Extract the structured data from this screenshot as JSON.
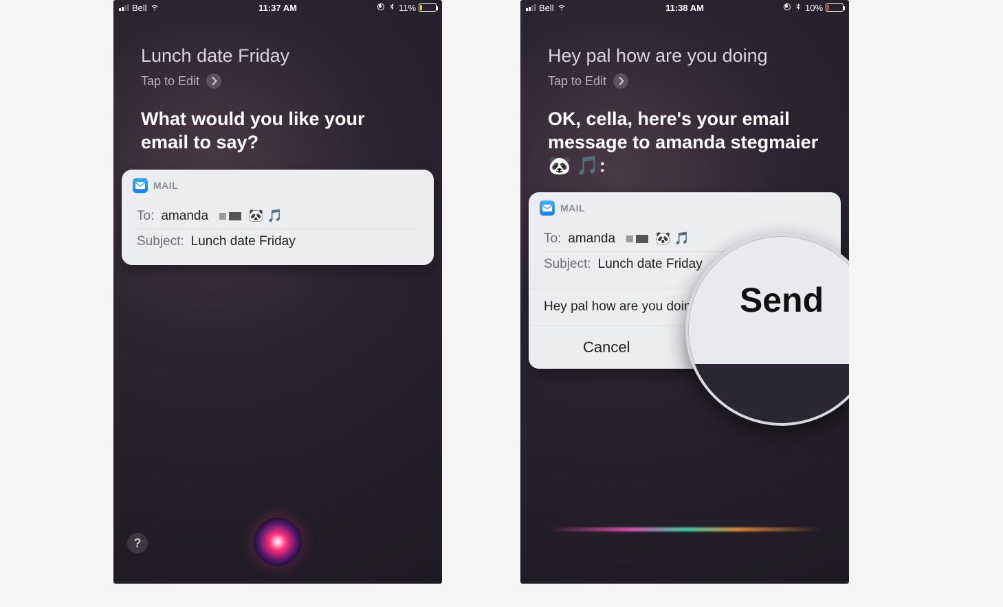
{
  "left": {
    "status": {
      "carrier": "Bell",
      "time": "11:37 AM",
      "battery_pct": "11%",
      "battery_color": "#ffcc00",
      "battery_fill_pct": 11
    },
    "user_said": "Lunch date Friday",
    "tap_to_edit": "Tap to Edit",
    "siri_prompt": "What would you like your email to say?",
    "mail": {
      "app_label": "MAIL",
      "to_label": "To:",
      "to_value": "amanda",
      "to_trailing": "🐼 🎵",
      "subject_label": "Subject:",
      "subject_value": "Lunch date Friday"
    }
  },
  "right": {
    "status": {
      "carrier": "Bell",
      "time": "11:38 AM",
      "battery_pct": "10%",
      "battery_color": "#ff3b30",
      "battery_fill_pct": 10
    },
    "user_said": "Hey pal how are you doing",
    "tap_to_edit": "Tap to Edit",
    "siri_prompt": "OK, cella, here's your email message to amanda stegmaier 🐼 🎵:",
    "mail": {
      "app_label": "MAIL",
      "to_label": "To:",
      "to_value": "amanda",
      "to_trailing": "🐼 🎵",
      "subject_label": "Subject:",
      "subject_value": "Lunch date Friday",
      "body": "Hey pal how are you doing",
      "cancel_label": "Cancel",
      "send_label": "Send"
    },
    "magnified_label": "Send"
  }
}
